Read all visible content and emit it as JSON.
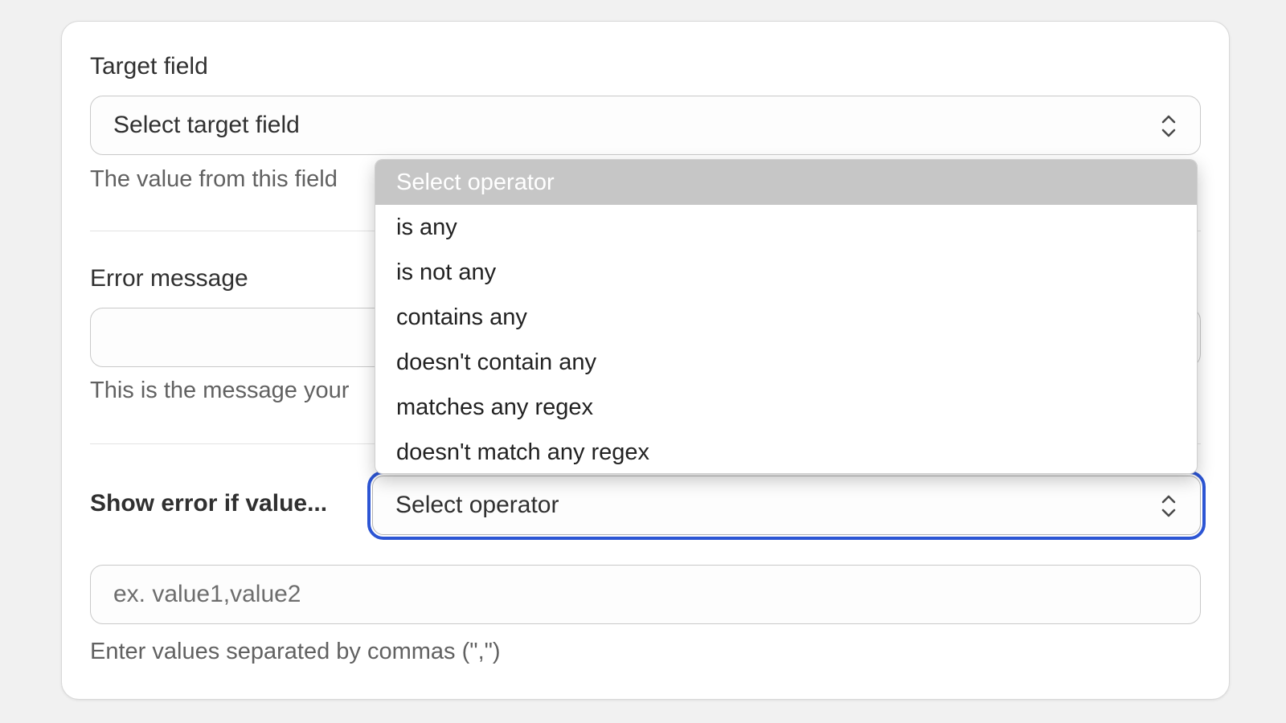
{
  "target_field": {
    "label": "Target field",
    "selected_value": "Select target field",
    "help": "The value from this field"
  },
  "error_message": {
    "label": "Error message",
    "value": "",
    "help": "This is the message your"
  },
  "condition": {
    "label": "Show error if value...",
    "operator_select": {
      "selected_value": "Select operator",
      "options": [
        "Select operator",
        "is any",
        "is not any",
        "contains any",
        "doesn't contain any",
        "matches any regex",
        "doesn't match any regex"
      ]
    },
    "values_input": {
      "placeholder": "ex. value1,value2",
      "help": "Enter values separated by commas (\",\")"
    }
  },
  "colors": {
    "focus_ring": "#2c55d4",
    "selected_option_bg": "#c6c6c6"
  },
  "icons": {
    "select_indicator": "chevron-up-down-icon"
  }
}
